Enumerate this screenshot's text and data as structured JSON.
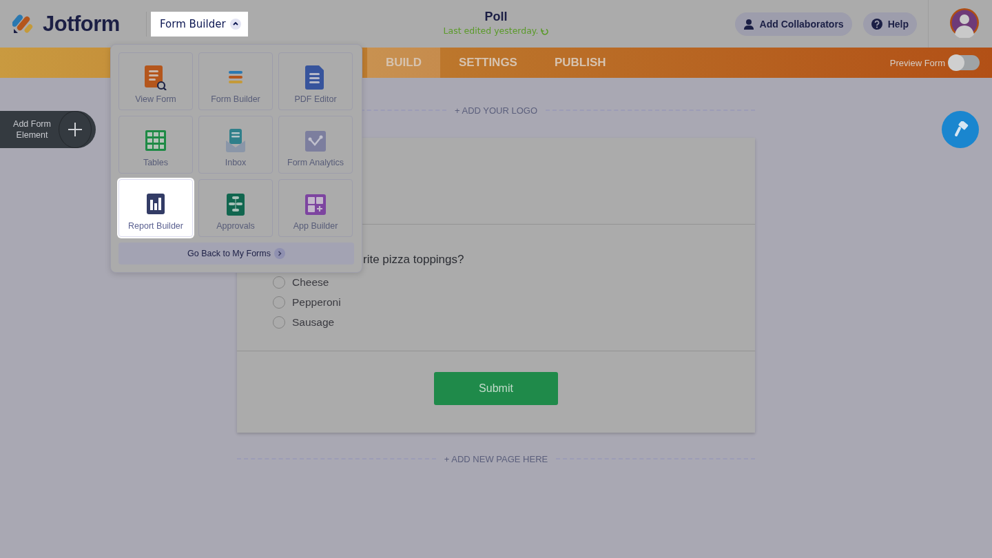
{
  "header": {
    "logo": "Jotform",
    "app_switcher": {
      "label": "Form Builder",
      "expanded": true
    },
    "title": "Poll",
    "subtitle": "Last edited yesterday.",
    "buttons": [
      {
        "label": "Add Collaborators",
        "kind": "collaborators"
      },
      {
        "label": "Help",
        "kind": "help"
      }
    ]
  },
  "nav": {
    "tabs": [
      {
        "label": "BUILD",
        "selected": true
      },
      {
        "label": "SETTINGS",
        "selected": false
      },
      {
        "label": "PUBLISH",
        "selected": false
      }
    ],
    "preview": {
      "label": "Preview Form",
      "on": false
    }
  },
  "app_menu": {
    "apps": [
      {
        "label": "View Form",
        "kind": "view",
        "selected": false
      },
      {
        "label": "Form Builder",
        "kind": "builder",
        "selected": false
      },
      {
        "label": "PDF Editor",
        "kind": "pdf",
        "selected": false
      },
      {
        "label": "Tables",
        "kind": "tables",
        "selected": false
      },
      {
        "label": "Inbox",
        "kind": "inbox",
        "selected": false
      },
      {
        "label": "Form Analytics",
        "kind": "analytics",
        "selected": false
      },
      {
        "label": "Report Builder",
        "kind": "report",
        "selected": true
      },
      {
        "label": "Approvals",
        "kind": "approvals",
        "selected": false
      },
      {
        "label": "App Builder",
        "kind": "app",
        "selected": false
      }
    ],
    "back_link": "Go Back to My Forms"
  },
  "add_element": "Add Form Element",
  "canvas": {
    "add_logo": "+ ADD YOUR LOGO",
    "question": "rite pizza toppings?",
    "options": [
      {
        "label": "Cheese",
        "selected": false
      },
      {
        "label": "Pepperoni",
        "selected": false
      },
      {
        "label": "Sausage",
        "selected": false
      }
    ],
    "submit": "Submit",
    "add_page": "+ ADD NEW PAGE HERE"
  }
}
